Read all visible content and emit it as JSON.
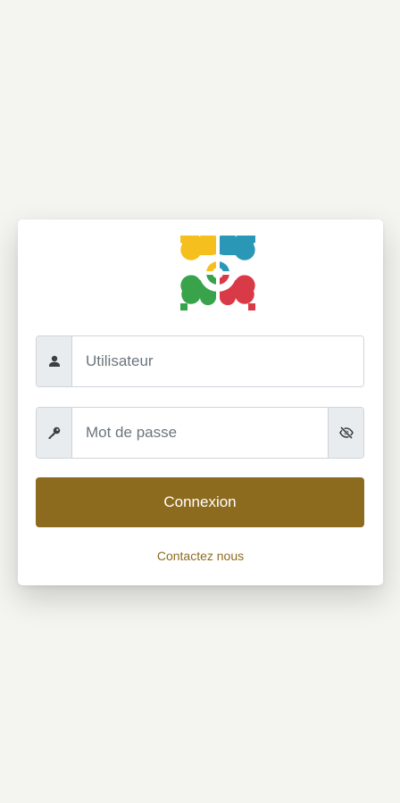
{
  "login": {
    "username_placeholder": "Utilisateur",
    "username_value": "",
    "password_placeholder": "Mot de passe",
    "password_value": "",
    "submit_label": "Connexion",
    "contact_label": "Contactez nous"
  },
  "icons": {
    "logo": "clover-crosshair-logo",
    "username": "user-icon",
    "password": "key-icon",
    "toggle_password": "eye-slash-icon"
  },
  "colors": {
    "background": "#f4f4f0",
    "accent": "#8c6b1f",
    "logo_yellow": "#f5bf1d",
    "logo_blue": "#2b97b6",
    "logo_green": "#38a34a",
    "logo_red": "#d93a47"
  }
}
